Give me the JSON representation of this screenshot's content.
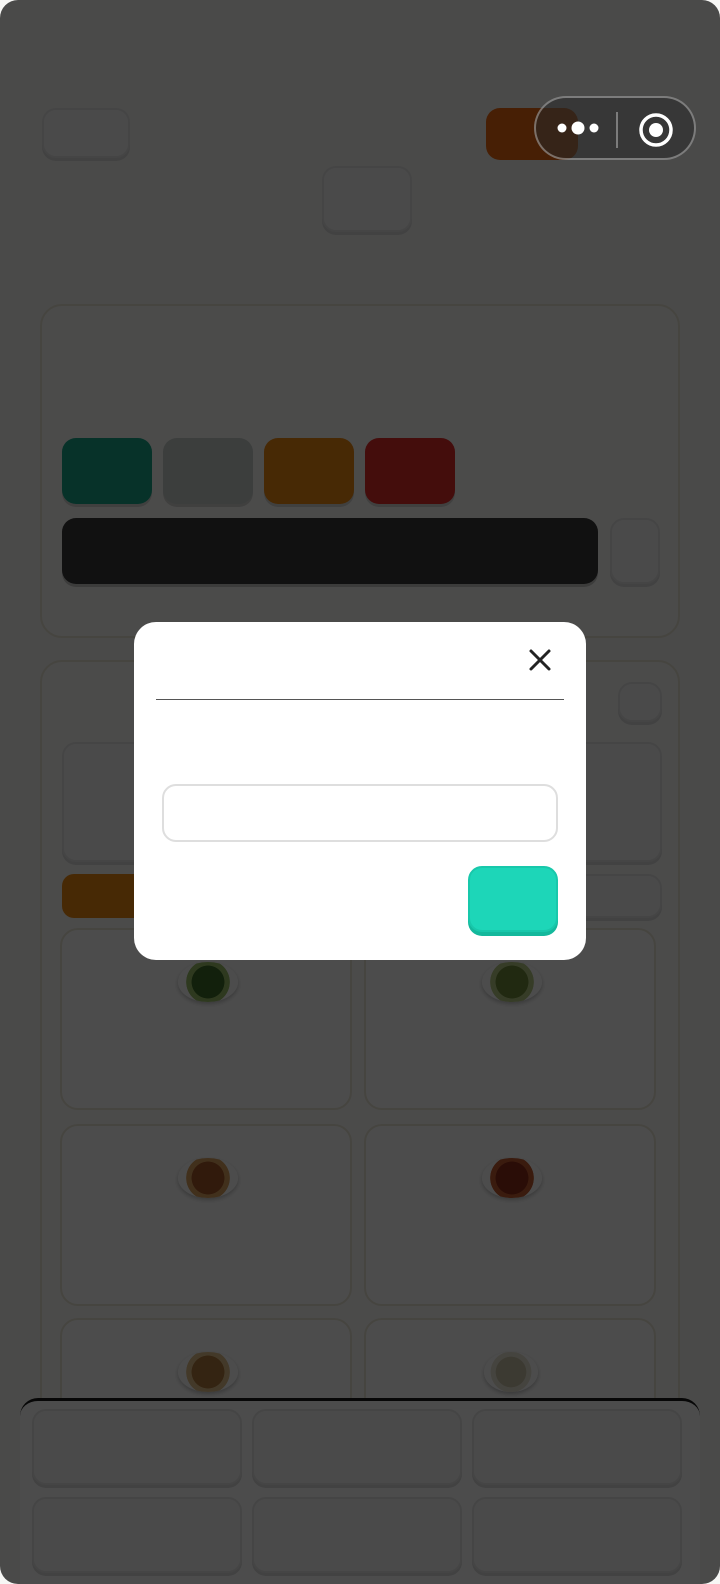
{
  "header": {
    "left_button_label": "",
    "right_button_label": "",
    "center_button_label": ""
  },
  "capsule": {
    "more_icon": "more-dots-icon",
    "close_icon": "target-circle-icon"
  },
  "colors": {
    "swatches": [
      "#1aa78a",
      "#c8d0cd",
      "#ef8a12",
      "#e42c2a"
    ],
    "accent": "#1dd6b8",
    "dark_bar": "#3a3a3a",
    "orange_tag": "#ef8a12"
  },
  "dialog": {
    "title": "",
    "close_icon": "close-icon",
    "message": "",
    "input_value": "",
    "input_placeholder": "",
    "confirm_label": ""
  },
  "food_items": [
    {
      "name": "",
      "dish_color": "#3f6b2a"
    },
    {
      "name": "",
      "dish_color": "#6f8a3a"
    },
    {
      "name": "",
      "dish_color": "#a4582a"
    },
    {
      "name": "",
      "dish_color": "#8e2c18"
    },
    {
      "name": "",
      "dish_color": "#b07a3c"
    },
    {
      "name": "",
      "dish_color": "#c9c2a8"
    }
  ],
  "bottom_bar": {
    "buttons": [
      "",
      "",
      "",
      "",
      "",
      ""
    ]
  }
}
